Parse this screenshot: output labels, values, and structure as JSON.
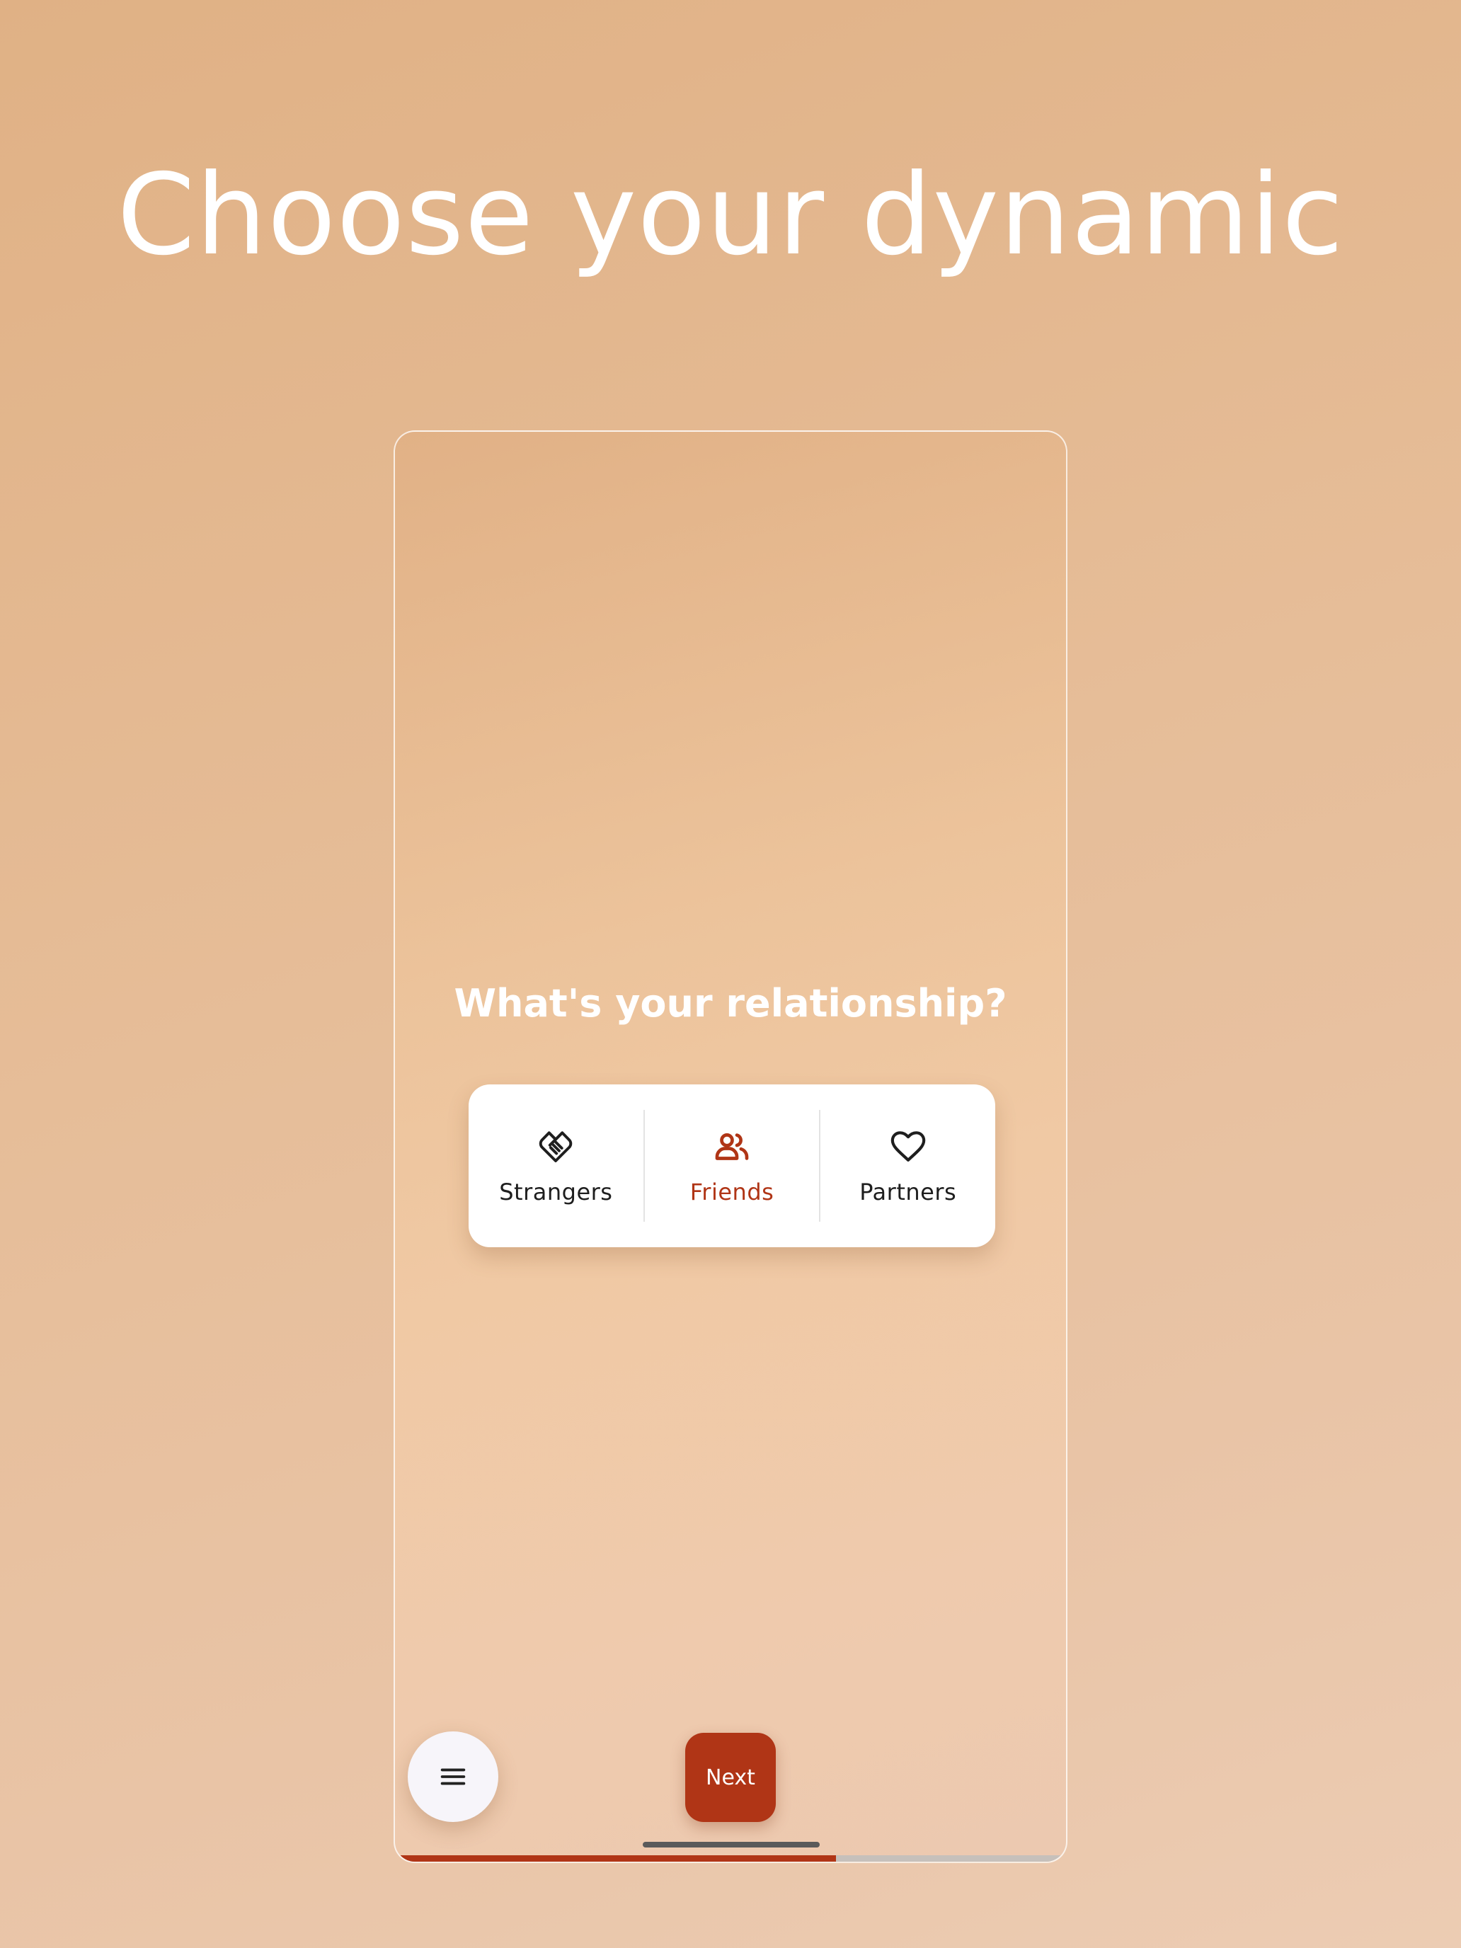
{
  "page": {
    "title": "Choose your dynamic"
  },
  "screen": {
    "question": "What's your relationship?",
    "options": [
      {
        "label": "Strangers",
        "icon": "handshake-icon",
        "selected": false
      },
      {
        "label": "Friends",
        "icon": "people-icon",
        "selected": true
      },
      {
        "label": "Partners",
        "icon": "heart-icon",
        "selected": false
      }
    ],
    "menu_icon": "menu-icon",
    "next_label": "Next",
    "progress_percent": 66
  },
  "colors": {
    "accent": "#b03516",
    "text_dark": "#1e1e1e",
    "title_text": "#ffffff",
    "card_bg": "#ffffff"
  }
}
